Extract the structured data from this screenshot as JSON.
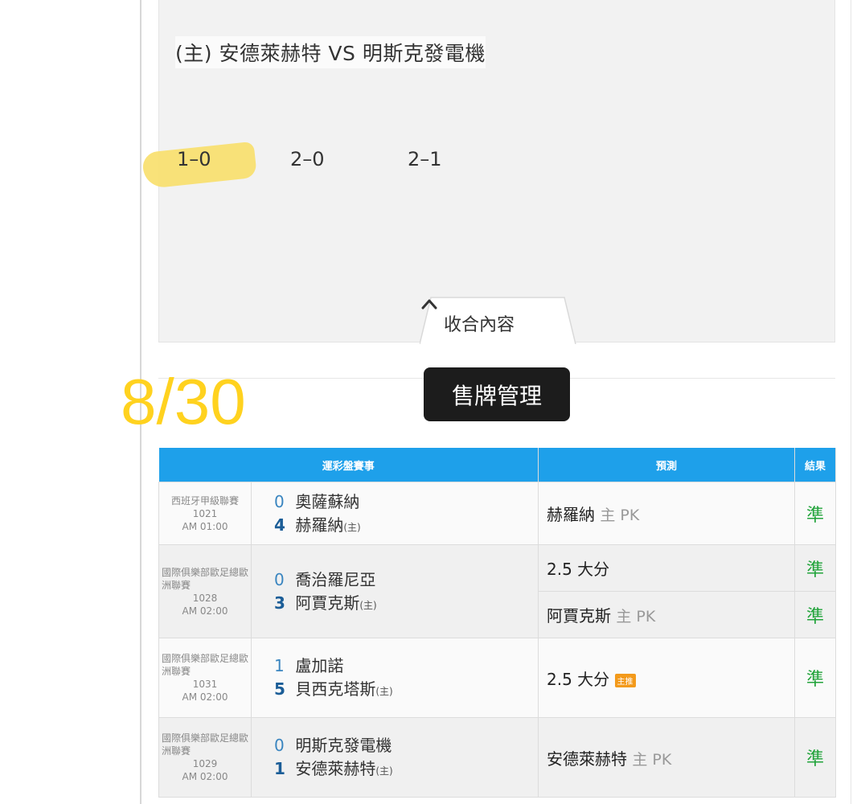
{
  "match": {
    "title": "(主) 安德萊赫特 VS 明斯克發電機",
    "scores": [
      "1–0",
      "2–0",
      "2–1"
    ]
  },
  "collapse": {
    "label": "收合內容"
  },
  "annotation": {
    "date": "8/30"
  },
  "tooltip": {
    "text": "售牌管理"
  },
  "table": {
    "headers": [
      "運彩盤賽事",
      "預測",
      "結果"
    ],
    "rows": [
      {
        "league": "西班牙甲級聯賽",
        "code": "1021",
        "time": "AM 01:00",
        "away_score": "0",
        "away_team": "奧薩蘇納",
        "home_score": "4",
        "home_team": "赫羅納",
        "home_tag": "(主)",
        "predictions": [
          {
            "team": "赫羅納",
            "pk": "主 PK",
            "result": "準"
          }
        ]
      },
      {
        "league": "國際俱樂部歐足總歐洲聯賽",
        "code": "1028",
        "time": "AM 02:00",
        "away_score": "0",
        "away_team": "喬治羅尼亞",
        "home_score": "3",
        "home_team": "阿賈克斯",
        "home_tag": "(主)",
        "predictions": [
          {
            "team": "2.5 大分",
            "pk": "",
            "result": "準"
          },
          {
            "team": "阿賈克斯",
            "pk": "主 PK",
            "result": "準"
          }
        ]
      },
      {
        "league": "國際俱樂部歐足總歐洲聯賽",
        "code": "1031",
        "time": "AM 02:00",
        "away_score": "1",
        "away_team": "盧加諾",
        "home_score": "5",
        "home_team": "貝西克塔斯",
        "home_tag": "(主)",
        "predictions": [
          {
            "team": "2.5 大分",
            "badge": "主推",
            "result": "準"
          }
        ]
      },
      {
        "league": "國際俱樂部歐足總歐洲聯賽",
        "code": "1029",
        "time": "AM 02:00",
        "away_score": "0",
        "away_team": "明斯克發電機",
        "home_score": "1",
        "home_team": "安德萊赫特",
        "home_tag": "(主)",
        "predictions": [
          {
            "team": "安德萊赫特",
            "pk": "主 PK",
            "result": "準"
          }
        ]
      }
    ]
  }
}
